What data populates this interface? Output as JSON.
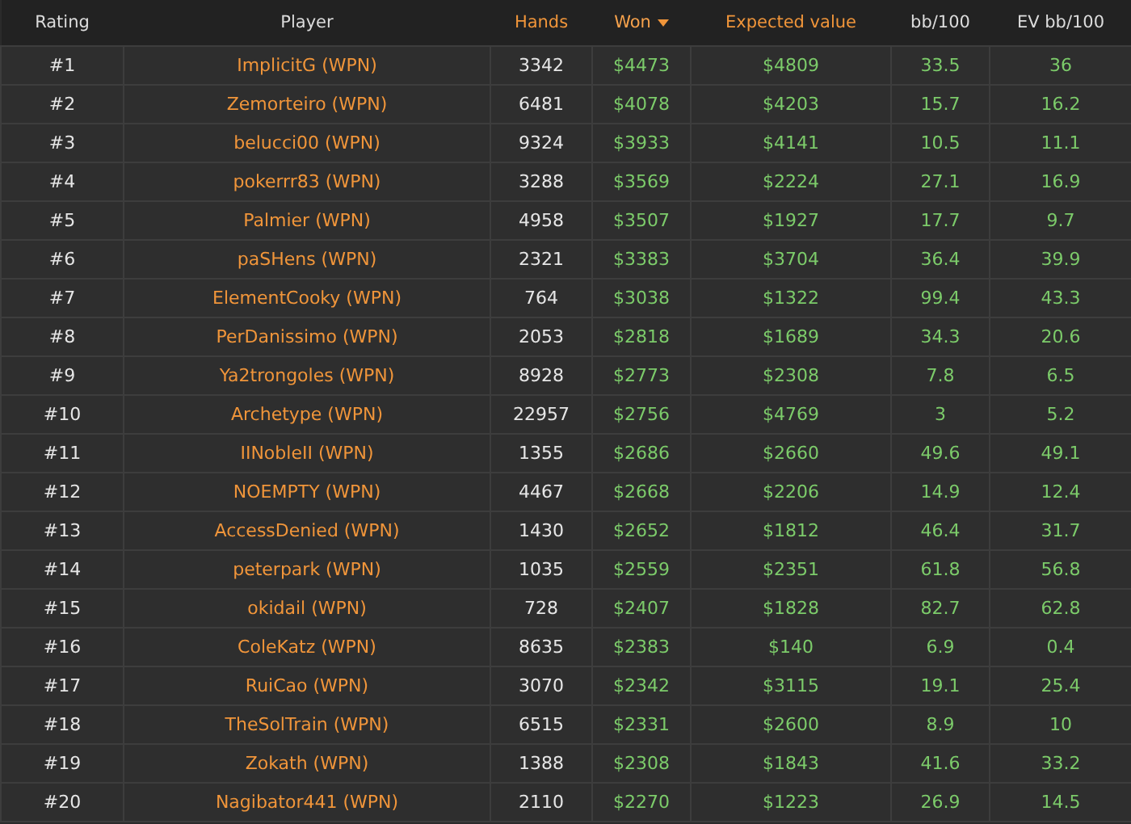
{
  "table": {
    "columns": [
      {
        "label": "Rating",
        "sortable": false,
        "selected": false
      },
      {
        "label": "Player",
        "sortable": false,
        "selected": false
      },
      {
        "label": "Hands",
        "sortable": true,
        "selected": false
      },
      {
        "label": "Won",
        "sortable": true,
        "selected": true
      },
      {
        "label": "Expected value",
        "sortable": true,
        "selected": false
      },
      {
        "label": "bb/100",
        "sortable": false,
        "selected": false
      },
      {
        "label": "EV bb/100",
        "sortable": false,
        "selected": false
      }
    ],
    "rows": [
      [
        "#1",
        "ImplicitG (WPN)",
        "3342",
        "$4473",
        "$4809",
        "33.5",
        "36"
      ],
      [
        "#2",
        "Zemorteiro (WPN)",
        "6481",
        "$4078",
        "$4203",
        "15.7",
        "16.2"
      ],
      [
        "#3",
        "belucci00 (WPN)",
        "9324",
        "$3933",
        "$4141",
        "10.5",
        "11.1"
      ],
      [
        "#4",
        "pokerrr83 (WPN)",
        "3288",
        "$3569",
        "$2224",
        "27.1",
        "16.9"
      ],
      [
        "#5",
        "Palmier (WPN)",
        "4958",
        "$3507",
        "$1927",
        "17.7",
        "9.7"
      ],
      [
        "#6",
        "paSHens (WPN)",
        "2321",
        "$3383",
        "$3704",
        "36.4",
        "39.9"
      ],
      [
        "#7",
        "ElementCooky (WPN)",
        "764",
        "$3038",
        "$1322",
        "99.4",
        "43.3"
      ],
      [
        "#8",
        "PerDanissimo (WPN)",
        "2053",
        "$2818",
        "$1689",
        "34.3",
        "20.6"
      ],
      [
        "#9",
        "Ya2trongoles (WPN)",
        "8928",
        "$2773",
        "$2308",
        "7.8",
        "6.5"
      ],
      [
        "#10",
        "Archetype (WPN)",
        "22957",
        "$2756",
        "$4769",
        "3",
        "5.2"
      ],
      [
        "#11",
        "IINobleII (WPN)",
        "1355",
        "$2686",
        "$2660",
        "49.6",
        "49.1"
      ],
      [
        "#12",
        "NOEMPTY (WPN)",
        "4467",
        "$2668",
        "$2206",
        "14.9",
        "12.4"
      ],
      [
        "#13",
        "AccessDenied (WPN)",
        "1430",
        "$2652",
        "$1812",
        "46.4",
        "31.7"
      ],
      [
        "#14",
        "peterpark (WPN)",
        "1035",
        "$2559",
        "$2351",
        "61.8",
        "56.8"
      ],
      [
        "#15",
        "okidail (WPN)",
        "728",
        "$2407",
        "$1828",
        "82.7",
        "62.8"
      ],
      [
        "#16",
        "ColeKatz (WPN)",
        "8635",
        "$2383",
        "$140",
        "6.9",
        "0.4"
      ],
      [
        "#17",
        "RuiCao (WPN)",
        "3070",
        "$2342",
        "$3115",
        "19.1",
        "25.4"
      ],
      [
        "#18",
        "TheSolTrain (WPN)",
        "6515",
        "$2331",
        "$2600",
        "8.9",
        "10"
      ],
      [
        "#19",
        "Zokath (WPN)",
        "1388",
        "$2308",
        "$1843",
        "41.6",
        "33.2"
      ],
      [
        "#20",
        "Nagibator441 (WPN)",
        "2110",
        "$2270",
        "$1223",
        "26.9",
        "14.5"
      ]
    ]
  }
}
